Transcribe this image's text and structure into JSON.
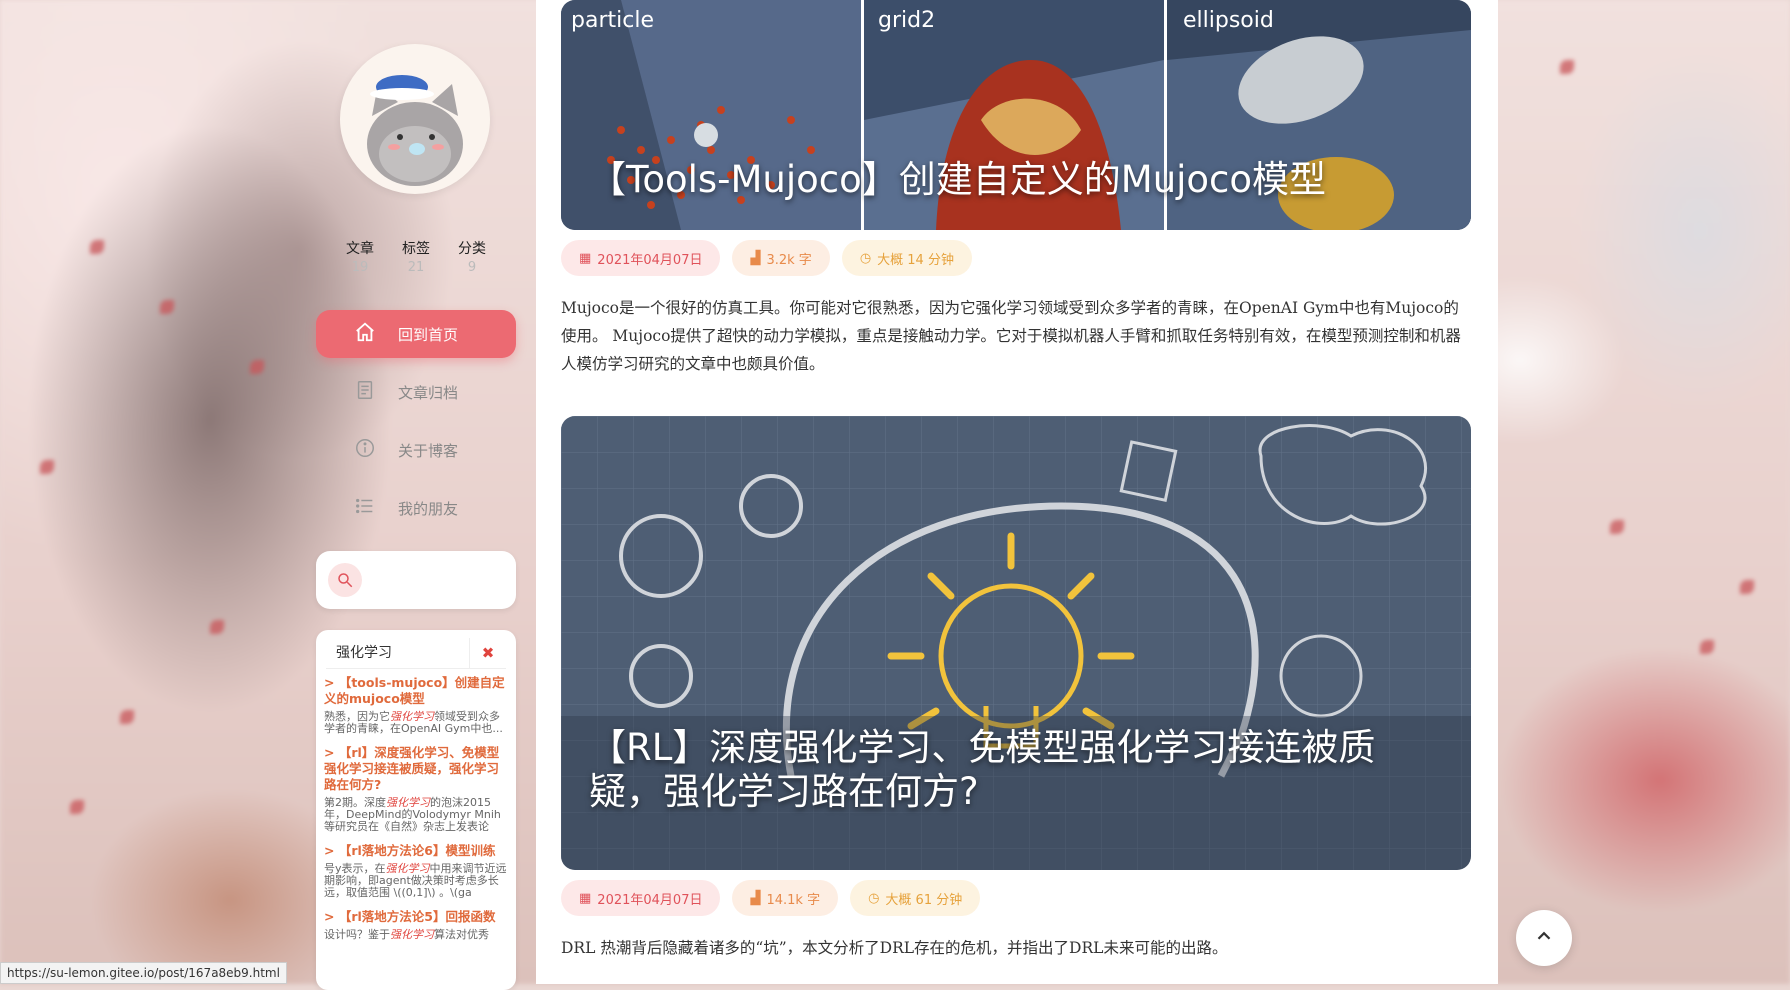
{
  "sidebar": {
    "stats": [
      {
        "label": "文章",
        "value": "19"
      },
      {
        "label": "标签",
        "value": "21"
      },
      {
        "label": "分类",
        "value": "9"
      }
    ],
    "nav": [
      {
        "label": "回到首页",
        "icon": "home-icon"
      },
      {
        "label": "文章归档",
        "icon": "archive-icon"
      },
      {
        "label": "关于博客",
        "icon": "info-icon"
      },
      {
        "label": "我的朋友",
        "icon": "list-icon"
      }
    ],
    "search": {
      "query": "强化学习",
      "close": "✖",
      "results": [
        {
          "title": "> 【tools-mujoco】创建自定义的mujoco模型",
          "pre": "熟悉，因为它",
          "hl": "强化学习",
          "post": "领域受到众多学者的青睐，在OpenAI Gym中也..."
        },
        {
          "title": "> 【rl】深度强化学习、免模型强化学习接连被质疑，强化学习路在何方?",
          "pre": "第2期。深度",
          "hl": "强化学习",
          "post": "的泡沫2015年，DeepMind的Volodymyr Mnih等研究员在《自然》杂志上发表论"
        },
        {
          "title": "> 【rl落地方法论6】模型训练",
          "pre": "号y表示，在",
          "hl": "强化学习",
          "post": "中用来调节近远期影响，即agent做决策时考虑多长远，取值范围 \\((0,1]\\) 。\\(ga"
        },
        {
          "title": "> 【rl落地方法论5】回报函数",
          "pre": "设计吗？鉴于",
          "hl": "强化学习",
          "post": "算法对优秀"
        }
      ]
    }
  },
  "posts": [
    {
      "cover_title": "【Tools-Mujoco】创建自定义的Mujoco模型",
      "panels": [
        "particle",
        "grid2",
        "ellipsoid"
      ],
      "date": "2021年04月07日",
      "words": "3.2k 字",
      "time": "大概 14 分钟",
      "excerpt": "Mujoco是一个很好的仿真工具。你可能对它很熟悉，因为它强化学习领域受到众多学者的青睐，在OpenAI Gym中也有Mujoco的使用。 Mujoco提供了超快的动力学模拟，重点是接触动力学。它对于模拟机器人手臂和抓取任务特别有效，在模型预测控制和机器人模仿学习研究的文章中也颇具价值。"
    },
    {
      "cover_title": "【RL】深度强化学习、免模型强化学习接连被质疑，强化学习路在何方?",
      "date": "2021年04月07日",
      "words": "14.1k 字",
      "time": "大概 61 分钟",
      "excerpt": "DRL 热潮背后隐藏着诸多的“坑”，本文分析了DRL存在的危机，并指出了DRL未来可能的出路。"
    }
  ],
  "status_url": "https://su-lemon.gitee.io/post/167a8eb9.html",
  "colors": {
    "accent": "#ec6a72",
    "date": "#e0525a",
    "words": "#e88a4a",
    "time": "#e6a23c"
  }
}
